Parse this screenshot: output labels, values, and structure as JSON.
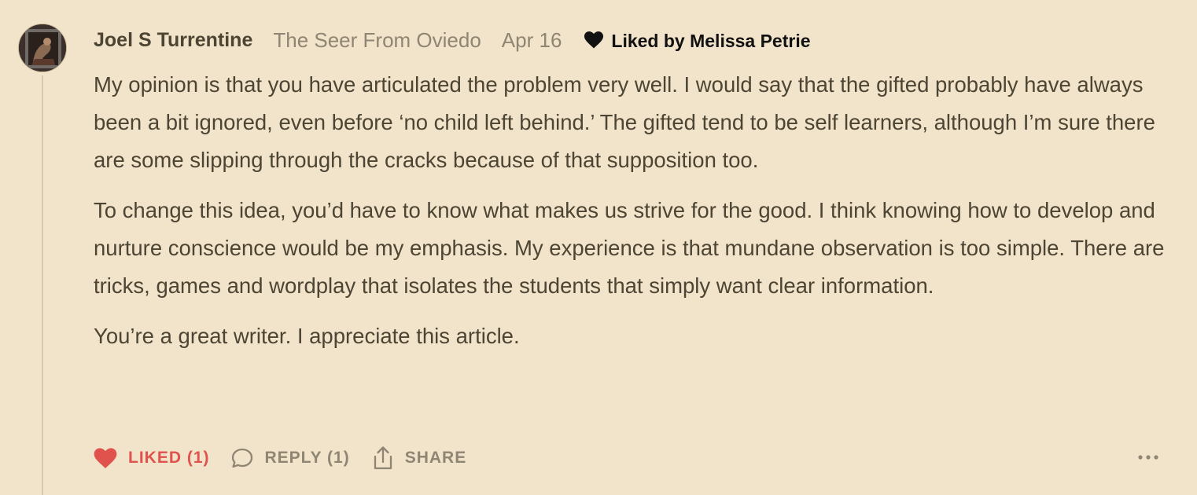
{
  "comment": {
    "author": "Joel S Turrentine",
    "publication": "The Seer From Oviedo",
    "date": "Apr 16",
    "liked_by": "Liked by Melissa Petrie",
    "paragraphs": [
      "My opinion is that you have articulated the problem very well. I would say that the gifted probably have always been a bit ignored, even before ‘no child left behind.’ The gifted tend to be self learners, although I’m sure there are some slipping through the cracks because of that supposition too.",
      "To change this idea, you’d have to know what makes us strive for the good. I think knowing how to develop and nurture conscience would be my emphasis. My experience is that mundane observation is too simple. There are tricks, games and wordplay that isolates the students that simply want clear information.",
      "You’re a great writer. I appreciate this article."
    ]
  },
  "actions": {
    "like_label": "LIKED (1)",
    "reply_label": "REPLY (1)",
    "share_label": "SHARE"
  },
  "icons": {
    "avatar": "avatar-photo",
    "liked_by": "heart-icon",
    "like": "heart-icon",
    "reply": "speech-bubble-icon",
    "share": "share-icon",
    "more": "ellipsis-icon"
  },
  "colors": {
    "background": "#f2e4ca",
    "text": "#4d4534",
    "muted": "#8f8573",
    "liked": "#e0524c"
  }
}
